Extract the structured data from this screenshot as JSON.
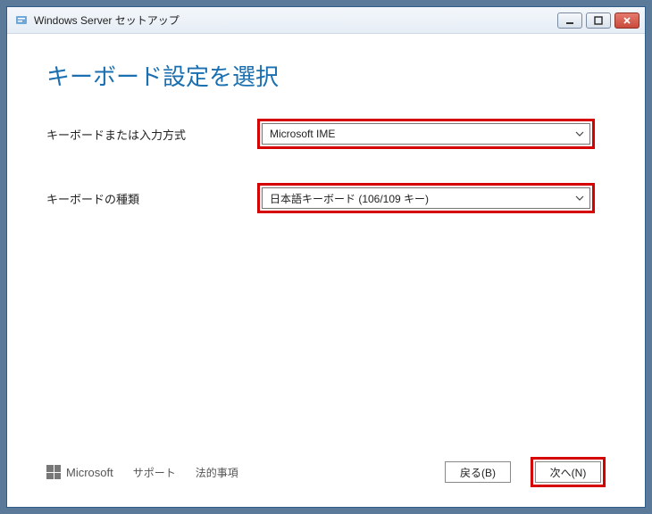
{
  "window": {
    "title": "Windows Server セットアップ"
  },
  "page": {
    "heading": "キーボード設定を選択",
    "fields": [
      {
        "label": "キーボードまたは入力方式",
        "value": "Microsoft IME"
      },
      {
        "label": "キーボードの種類",
        "value": "日本語キーボード (106/109 キー)"
      }
    ]
  },
  "footer": {
    "brand": "Microsoft",
    "links": {
      "support": "サポート",
      "legal": "法的事項"
    },
    "buttons": {
      "back": "戻る(B)",
      "next": "次へ(N)"
    }
  }
}
